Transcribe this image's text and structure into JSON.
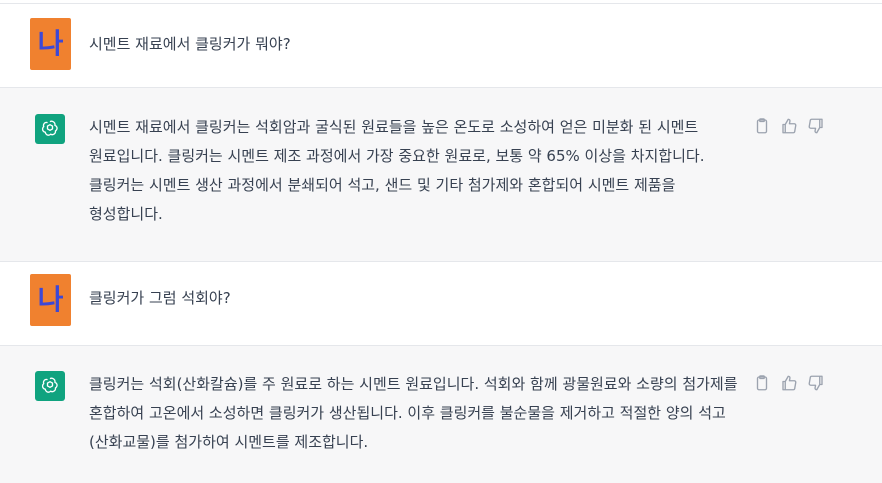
{
  "conversation": {
    "messages": [
      {
        "role": "user",
        "avatar_text": "나",
        "text": "시멘트 재료에서 클링커가 뭐야?"
      },
      {
        "role": "assistant",
        "text": "시멘트 재료에서 클링커는 석회암과 굴식된 원료들을 높은 온도로 소성하여 얻은 미분화 된 시멘트 원료입니다. 클링커는 시멘트 제조 과정에서 가장 중요한 원료로, 보통 약 65% 이상을 차지합니다. 클링커는 시멘트 생산 과정에서 분쇄되어 석고, 샌드 및 기타 첨가제와 혼합되어 시멘트 제품을 형성합니다."
      },
      {
        "role": "user",
        "avatar_text": "나",
        "text": "클링커가 그럼 석회야?"
      },
      {
        "role": "assistant",
        "text": "클링커는 석회(산화칼슘)를 주 원료로 하는 시멘트 원료입니다. 석회와 함께 광물원료와 소량의 첨가제를 혼합하여 고온에서 소성하면 클링커가 생산됩니다. 이후 클링커를 불순물을 제거하고 적절한 양의 석고(산화교물)를 첨가하여 시멘트를 제조합니다."
      }
    ]
  },
  "icons": {
    "assistant_avatar": "openai-logo-icon",
    "copy": "clipboard-icon",
    "like": "thumbs-up-icon",
    "dislike": "thumbs-down-icon"
  },
  "colors": {
    "user_avatar_bg": "#f0812f",
    "user_avatar_text": "#3d48d6",
    "assistant_avatar_bg": "#10a37f",
    "assistant_row_bg": "#f7f7f8",
    "user_row_bg": "#ffffff",
    "text": "#374151",
    "icon": "#9ca3af"
  }
}
